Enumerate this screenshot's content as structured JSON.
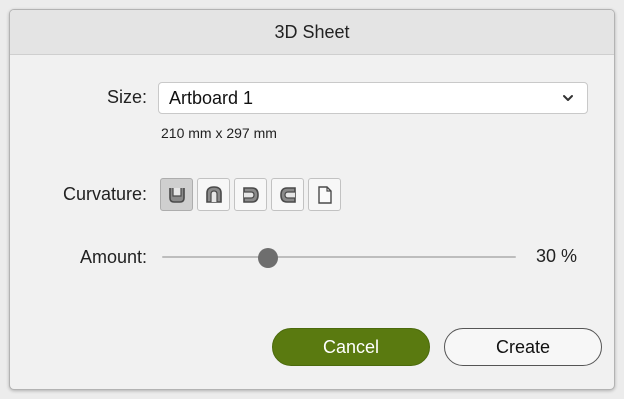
{
  "dialog": {
    "title": "3D Sheet"
  },
  "size": {
    "label": "Size:",
    "selected": "Artboard 1",
    "dimensions": "210 mm x 297 mm"
  },
  "curvature": {
    "label": "Curvature:",
    "options": [
      {
        "icon": "curvature-bucket-icon",
        "selected": true
      },
      {
        "icon": "curvature-cylinder-icon",
        "selected": false
      },
      {
        "icon": "curvature-half-roll-icon",
        "selected": false
      },
      {
        "icon": "curvature-roll-icon",
        "selected": false
      },
      {
        "icon": "curvature-flat-page-icon",
        "selected": false
      }
    ]
  },
  "amount": {
    "label": "Amount:",
    "value": 30,
    "display": "30 %"
  },
  "buttons": {
    "cancel": "Cancel",
    "create": "Create"
  },
  "colors": {
    "primary_button": "#5a7a10",
    "slider_thumb": "#6e6e6e"
  }
}
